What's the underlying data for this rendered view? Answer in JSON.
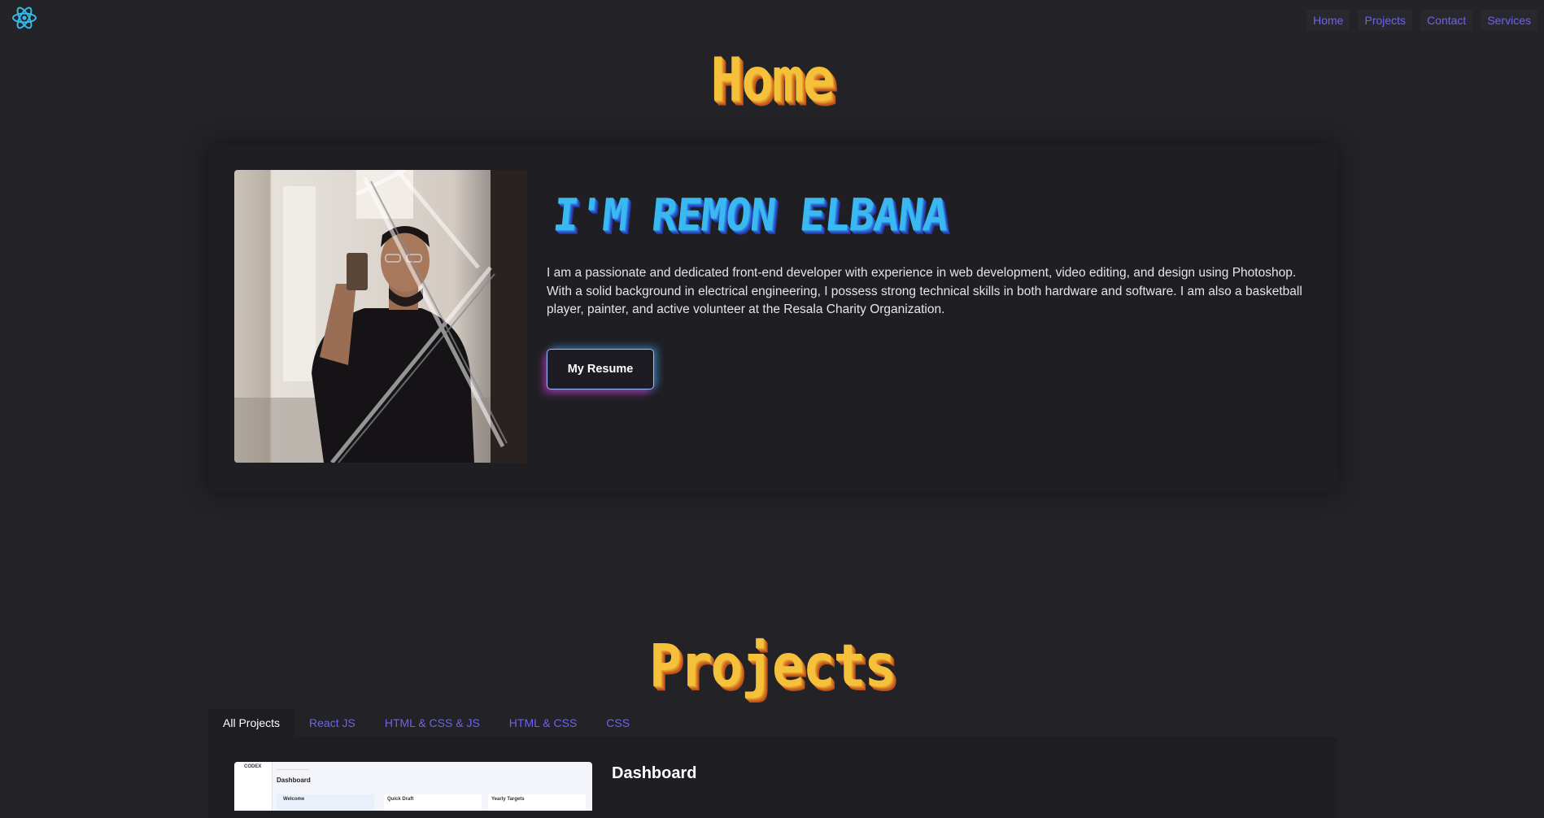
{
  "nav": {
    "logo_icon": "react-atom-icon",
    "links": [
      "Home",
      "Projects",
      "Contact",
      "Services"
    ],
    "link_color": "#6d63f5"
  },
  "home": {
    "title": "Home",
    "name": "I'M REMON ELBANA",
    "bio": "I am a passionate and dedicated front-end developer with experience in web development, video editing, and design using Photoshop. With a solid background in electrical engineering, I possess strong technical skills in both hardware and software. I am also a basketball player, painter, and active volunteer at the Resala Charity Organization.",
    "resume_button": "My Resume"
  },
  "projects": {
    "title": "Projects",
    "tabs": [
      "All Projects",
      "React JS",
      "HTML & CSS & JS",
      "HTML & CSS",
      "CSS"
    ],
    "active_tab": "All Projects",
    "items": [
      {
        "title": "Dashboard",
        "thumb": {
          "brand": "CODEX",
          "heading": "Dashboard",
          "cards": [
            "Welcome",
            "Quick Draft",
            "Yearly Targets"
          ]
        }
      }
    ]
  },
  "colors": {
    "background": "#232227",
    "card": "#1f1e23",
    "title_gold": "#f5c13a",
    "name_blue": "#3ab8f0",
    "accent": "#6d63f5"
  }
}
